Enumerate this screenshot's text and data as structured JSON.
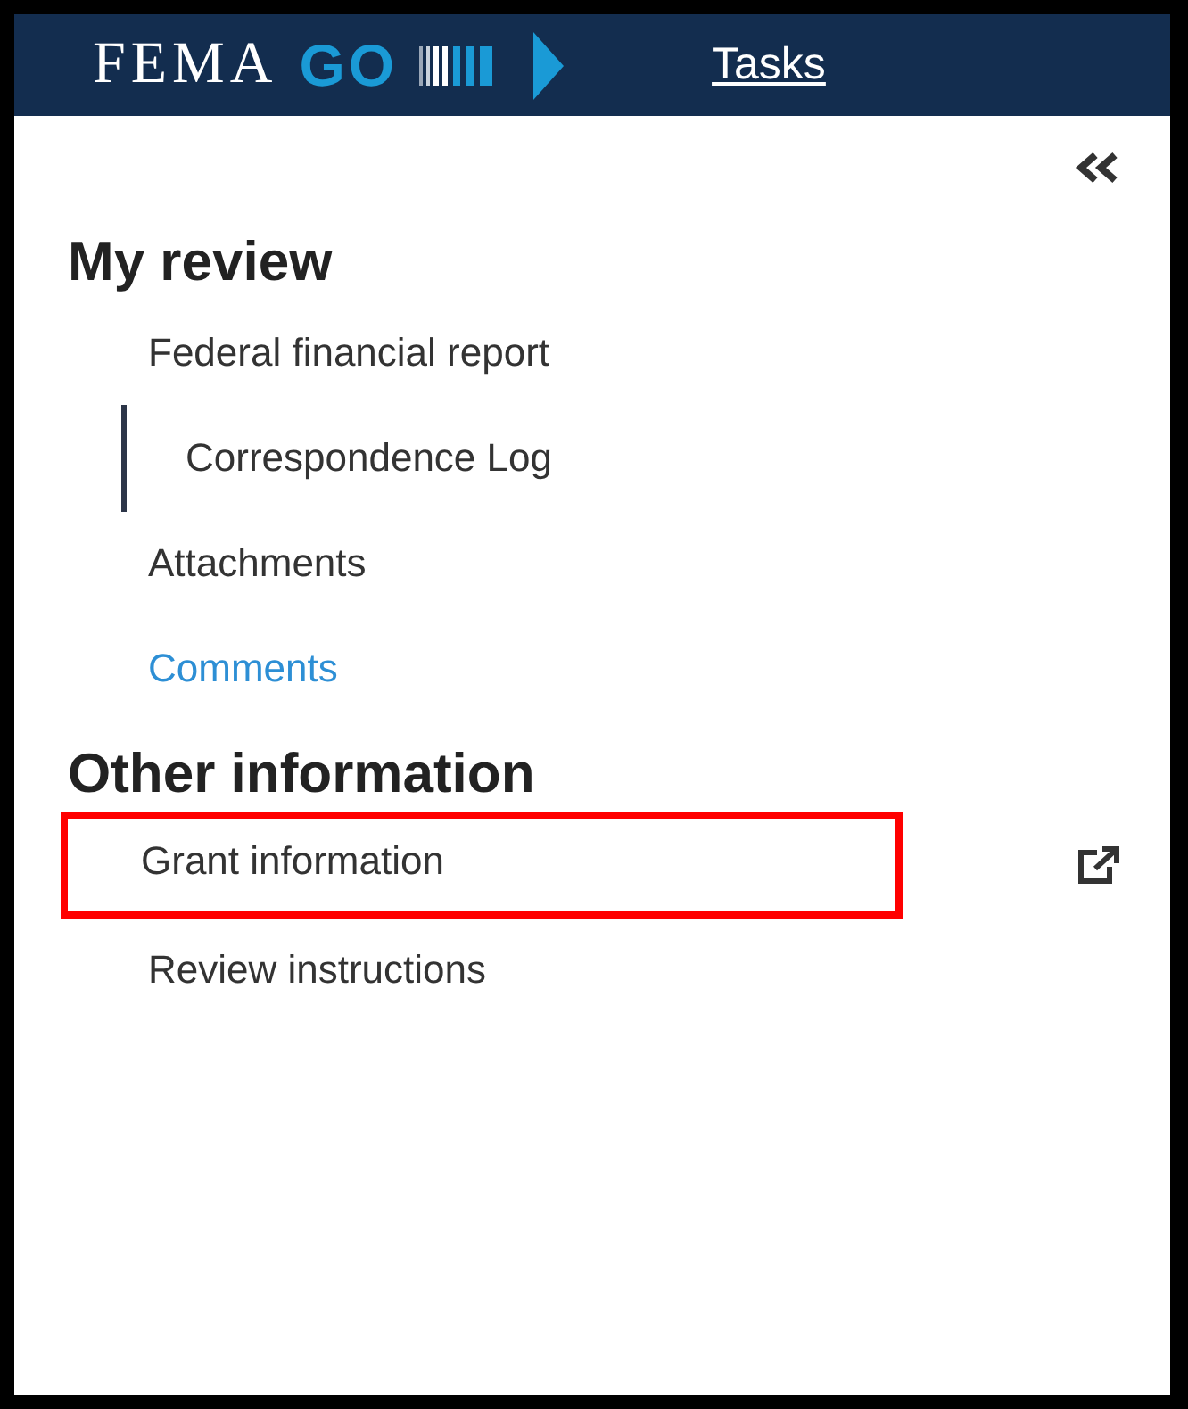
{
  "header": {
    "logo": {
      "wordmark": "FEMA",
      "accent": "GO"
    },
    "nav_link": "Tasks"
  },
  "sections": [
    {
      "heading": "My review",
      "items": [
        {
          "label": "Federal financial report",
          "kind": "plain",
          "selected": false,
          "highlighted": false,
          "external": false
        },
        {
          "label": "Correspondence Log",
          "kind": "plain",
          "selected": true,
          "highlighted": false,
          "external": false
        },
        {
          "label": "Attachments",
          "kind": "plain",
          "selected": false,
          "highlighted": false,
          "external": false
        },
        {
          "label": "Comments",
          "kind": "link",
          "selected": false,
          "highlighted": false,
          "external": false
        }
      ]
    },
    {
      "heading": "Other information",
      "items": [
        {
          "label": "Grant information",
          "kind": "plain",
          "selected": false,
          "highlighted": true,
          "external": true
        },
        {
          "label": "Review instructions",
          "kind": "plain",
          "selected": false,
          "highlighted": false,
          "external": false
        }
      ]
    }
  ]
}
